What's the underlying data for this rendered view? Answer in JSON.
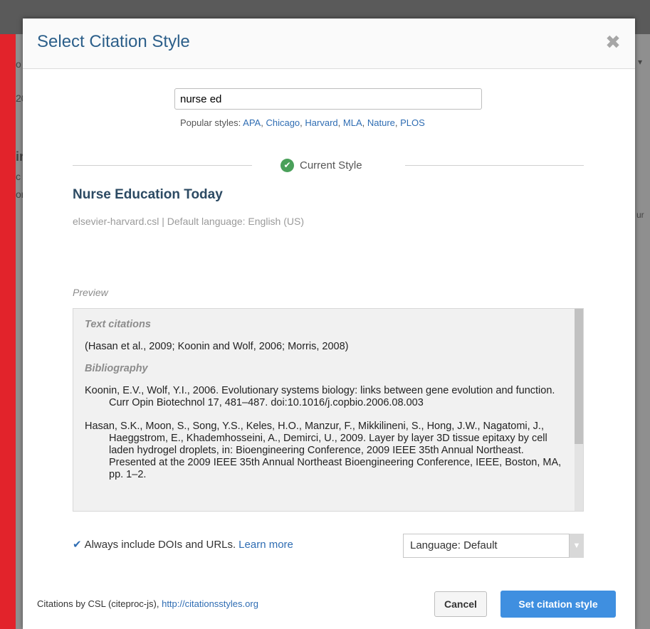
{
  "background": {
    "fragments": [
      "o",
      "20",
      "ir",
      "c",
      "or",
      "ur",
      "▾"
    ]
  },
  "dialog": {
    "title": "Select Citation Style",
    "close_icon": "✖"
  },
  "search": {
    "value": "nurse ed"
  },
  "popular": {
    "label": "Popular styles:",
    "styles": [
      "APA",
      "Chicago",
      "Harvard",
      "MLA",
      "Nature",
      "PLOS"
    ]
  },
  "current": {
    "label": "Current Style",
    "style_name": "Nurse Education Today",
    "meta": "elsevier-harvard.csl | Default language: English (US)"
  },
  "preview": {
    "label": "Preview",
    "text_citations_heading": "Text citations",
    "text_citation": "(Hasan et al., 2009; Koonin and Wolf, 2006; Morris, 2008)",
    "bibliography_heading": "Bibliography",
    "bibliography": [
      "Koonin, E.V., Wolf, Y.I., 2006. Evolutionary systems biology: links between gene evolution and function. Curr Opin Biotechnol 17, 481–487. doi:10.1016/j.copbio.2006.08.003",
      "Hasan, S.K., Moon, S., Song, Y.S., Keles, H.O., Manzur, F., Mikkilineni, S., Hong, J.W., Nagatomi, J., Haeggstrom, E., Khademhosseini, A., Demirci, U., 2009. Layer by layer 3D tissue epitaxy by cell laden hydrogel droplets, in: Bioengineering Conference, 2009 IEEE 35th Annual Northeast. Presented at the 2009 IEEE 35th Annual Northeast Bioengineering Conference, IEEE, Boston, MA, pp. 1–2."
    ]
  },
  "options": {
    "doi_label": "Always include DOIs and URLs.",
    "learn_more": "Learn more",
    "doi_checked": true,
    "language_value": "Language: Default"
  },
  "footer": {
    "credit_text": "Citations by CSL (citeproc-js),",
    "credit_link": "http://citationsstyles.org",
    "cancel_label": "Cancel",
    "submit_label": "Set citation style"
  },
  "colors": {
    "accent": "#3f8fe0",
    "title": "#2c5f8a",
    "check": "#4aa05a",
    "background_red": "#d4202a"
  }
}
